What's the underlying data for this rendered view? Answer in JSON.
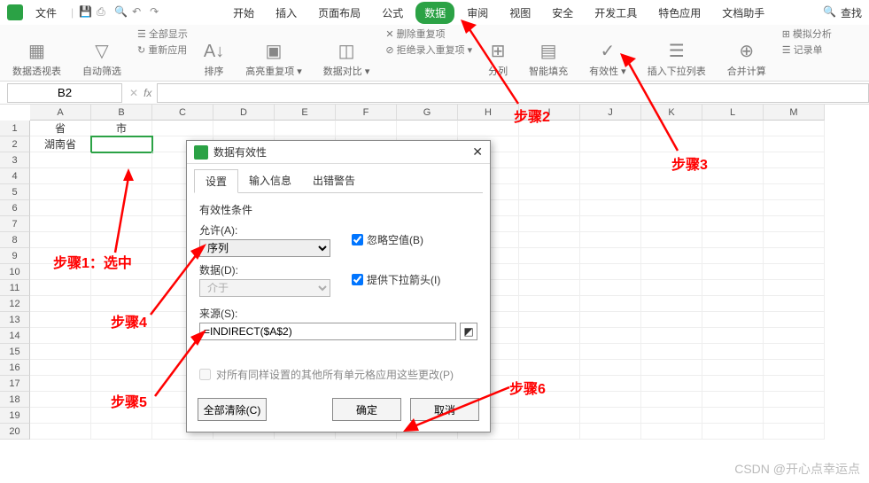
{
  "menubar": {
    "file": "文件",
    "items": [
      "开始",
      "插入",
      "页面布局",
      "公式",
      "数据",
      "审阅",
      "视图",
      "安全",
      "开发工具",
      "特色应用",
      "文档助手"
    ],
    "active_index": 4,
    "search": "查找"
  },
  "toolbar": {
    "pivot": "数据透视表",
    "autofilter": "自动筛选",
    "showall": "全部显示",
    "reapply": "重新应用",
    "sort": "排序",
    "highlight": "高亮重复项",
    "compare": "数据对比",
    "delete_dup": "删除重复项",
    "reject_dup": "拒绝录入重复项",
    "text_to_col": "分列",
    "flash_fill": "智能填充",
    "validation": "有效性",
    "insert_dropdown": "插入下拉列表",
    "consolidate": "合并计算",
    "what_if": "模拟分析",
    "record": "记录单"
  },
  "namebox": {
    "value": "B2"
  },
  "grid": {
    "cols": [
      "A",
      "B",
      "C",
      "D",
      "E",
      "F",
      "G",
      "H",
      "I",
      "J",
      "K",
      "L",
      "M"
    ],
    "rows": 20,
    "a1": "省",
    "b1": "市",
    "a2": "湖南省"
  },
  "dialog": {
    "title": "数据有效性",
    "tabs": [
      "设置",
      "输入信息",
      "出错警告"
    ],
    "active_tab": 0,
    "criteria_label": "有效性条件",
    "allow_label": "允许(A):",
    "allow_value": "序列",
    "data_label": "数据(D):",
    "data_value": "介于",
    "ignore_blank": "忽略空值(B)",
    "in_cell_dropdown": "提供下拉箭头(I)",
    "source_label": "来源(S):",
    "source_value": "=INDIRECT($A$2)",
    "apply_others": "对所有同样设置的其他所有单元格应用这些更改(P)",
    "clear_all": "全部清除(C)",
    "ok": "确定",
    "cancel": "取消"
  },
  "annotations": {
    "step1": "步骤1：选中",
    "step2": "步骤2",
    "step3": "步骤3",
    "step4": "步骤4",
    "step5": "步骤5",
    "step6": "步骤6"
  },
  "watermark": "CSDN @开心点幸运点"
}
